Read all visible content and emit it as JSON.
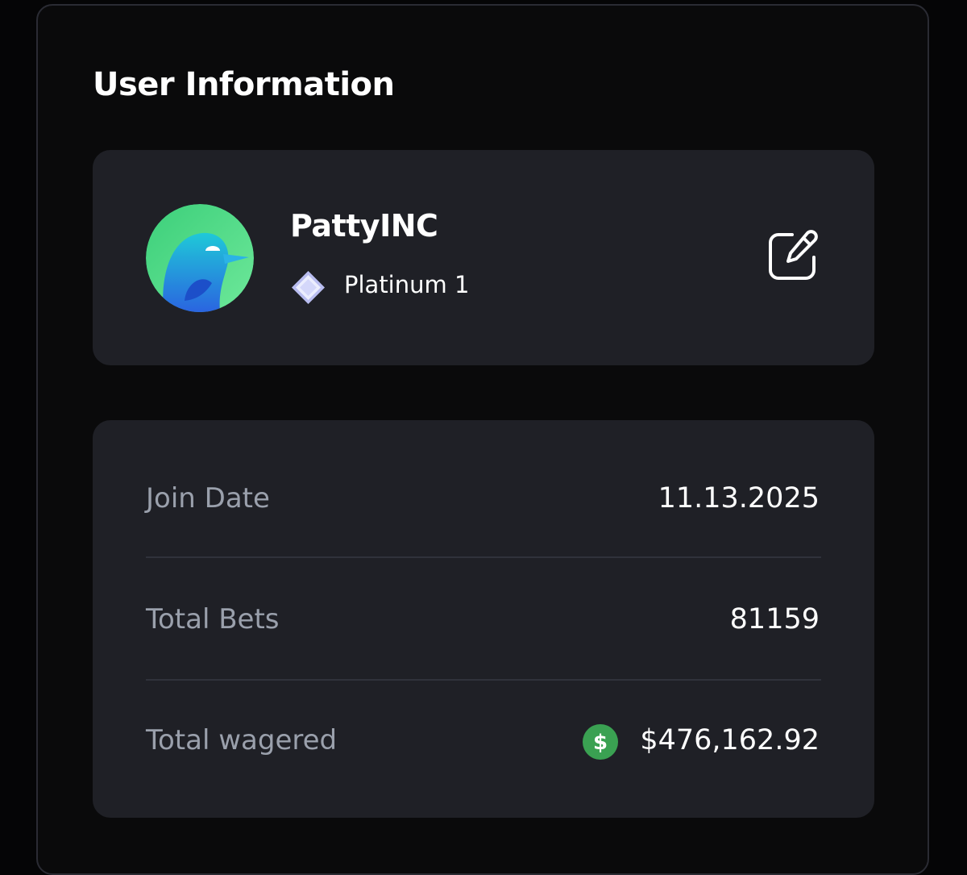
{
  "section": {
    "title": "User Information"
  },
  "profile": {
    "username": "PattyINC",
    "rank": "Platinum 1",
    "avatar_icon": "penguin-avatar-icon",
    "rank_icon": "platinum-gem-icon",
    "edit_icon": "edit-pencil-icon"
  },
  "stats": [
    {
      "label": "Join Date",
      "value": "11.13.2025"
    },
    {
      "label": "Total Bets",
      "value": "81159"
    },
    {
      "label": "Total wagered",
      "value": "$476,162.92",
      "icon": "dollar-coin-icon"
    }
  ],
  "colors": {
    "background": "#0a0a0b",
    "card": "#1f2026",
    "label": "#9aa0ac",
    "value": "#ffffff",
    "coin": "#3aa152"
  }
}
